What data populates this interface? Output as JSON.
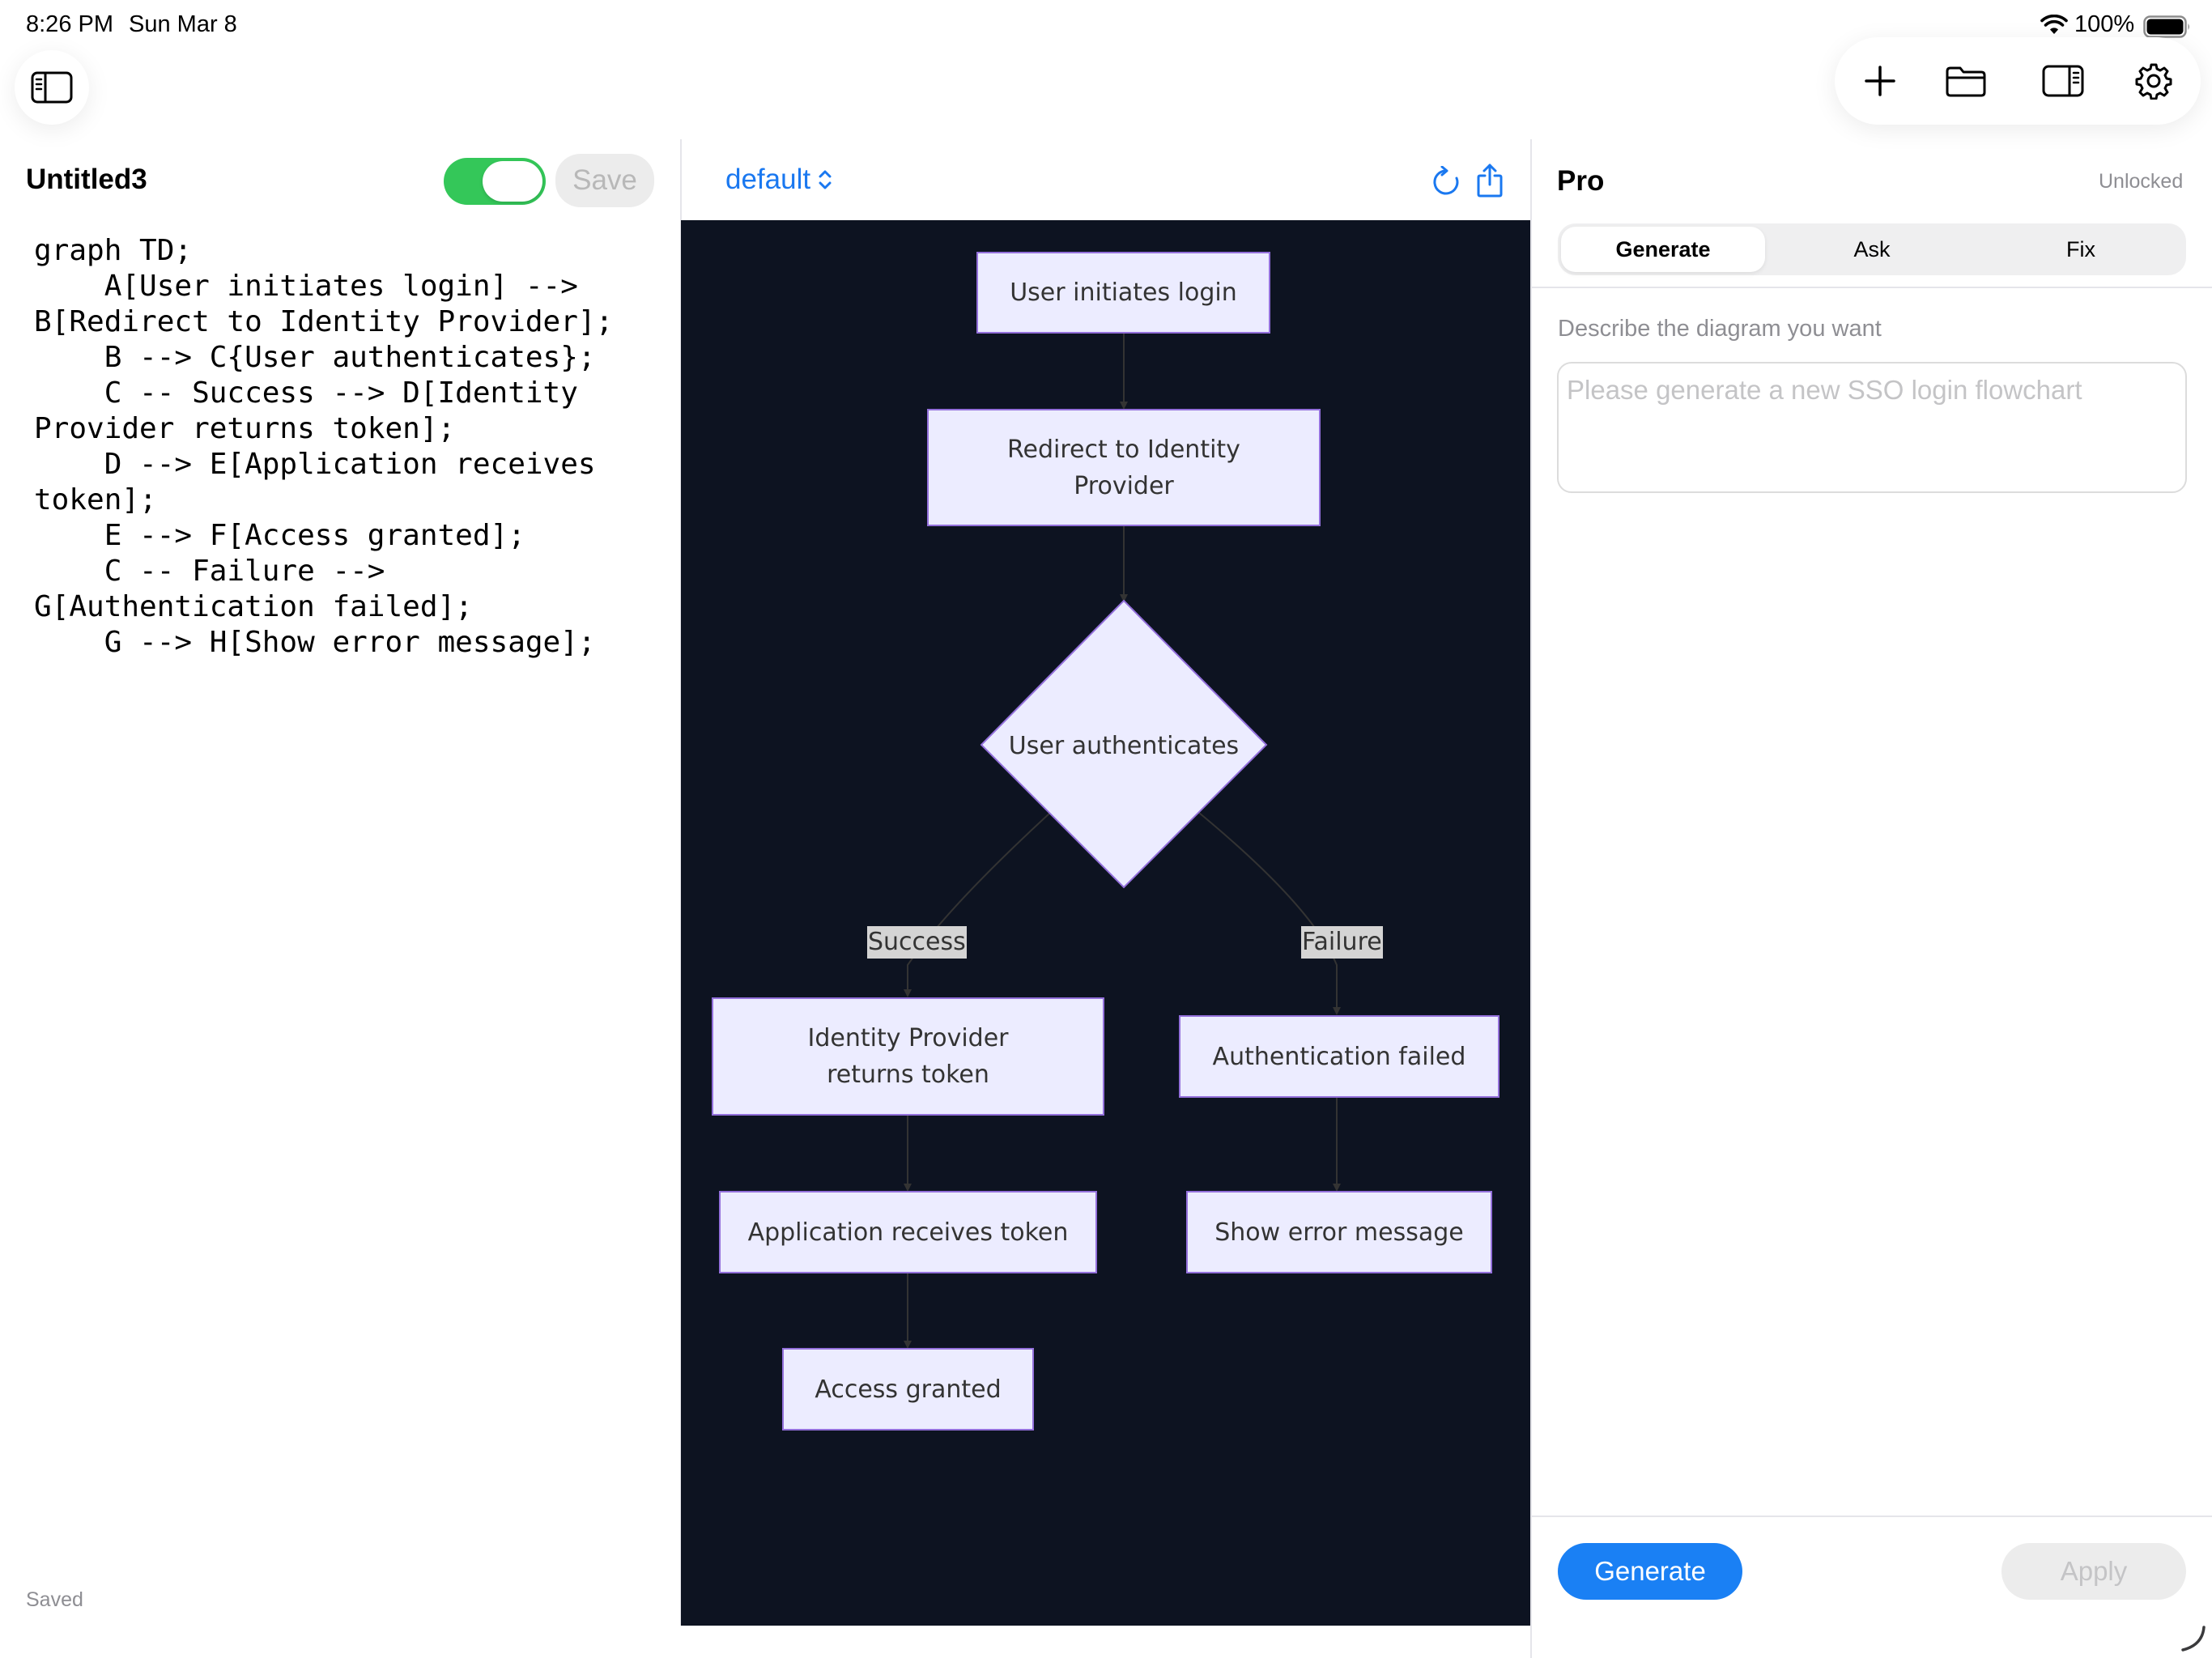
{
  "status_bar": {
    "time": "8:26 PM",
    "date": "Sun Mar 8",
    "battery": "100%"
  },
  "editor": {
    "file_name": "Untitled3",
    "save_label": "Save",
    "autosave_on": true,
    "status": "Saved",
    "code": "graph TD;\n    A[User initiates login] -->\nB[Redirect to Identity Provider];\n    B --> C{User authenticates};\n    C -- Success --> D[Identity\nProvider returns token];\n    D --> E[Application receives\ntoken];\n    E --> F[Access granted];\n    C -- Failure -->\nG[Authentication failed];\n    G --> H[Show error message];"
  },
  "preview": {
    "theme": "default",
    "nodes": {
      "a": "User initiates login",
      "b": "Redirect to Identity Provider",
      "c": "User authenticates",
      "d": "Identity Provider returns token",
      "e": "Application receives token",
      "f": "Access granted",
      "g": "Authentication failed",
      "h": "Show error message"
    },
    "edge_labels": {
      "success": "Success",
      "failure": "Failure"
    }
  },
  "pro_panel": {
    "title": "Pro",
    "status": "Unlocked",
    "tabs": [
      "Generate",
      "Ask",
      "Fix"
    ],
    "active_tab": "Generate",
    "prompt_label": "Describe the diagram you want",
    "prompt_placeholder": "Please generate a new SSO login flowchart",
    "generate_label": "Generate",
    "apply_label": "Apply"
  },
  "colors": {
    "accent": "#1a80f4",
    "toggle_on": "#34c759",
    "canvas_bg": "#0d1321",
    "node_fill": "#ececff",
    "node_border": "#9370db"
  }
}
